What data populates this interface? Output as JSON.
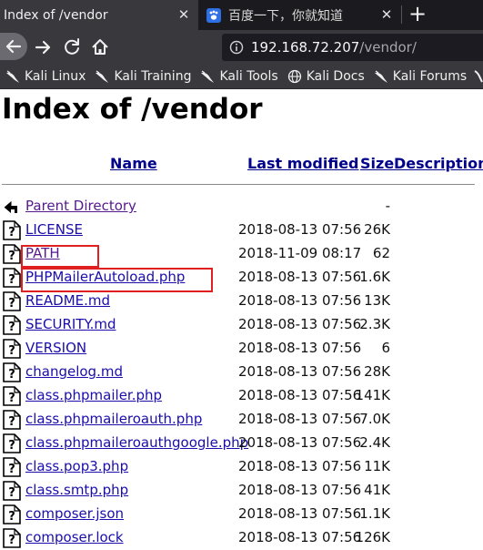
{
  "browser": {
    "tabs": [
      {
        "title": "Index of /vendor",
        "active": true
      },
      {
        "title": "百度一下，你就知道",
        "active": false,
        "icon": "baidu-paw-icon"
      }
    ],
    "url_host": "192.168.72.207",
    "url_path": "/vendor/",
    "bookmarks": [
      {
        "label": "Kali Linux",
        "icon": "kali-dragon-icon"
      },
      {
        "label": "Kali Training",
        "icon": "kali-dragon-icon"
      },
      {
        "label": "Kali Tools",
        "icon": "kali-dragon-icon"
      },
      {
        "label": "Kali Docs",
        "icon": "globe-icon"
      },
      {
        "label": "Kali Forums",
        "icon": "kali-dragon-icon"
      }
    ]
  },
  "page": {
    "title": "Index of /vendor",
    "headers": {
      "name": "Name",
      "last_modified": "Last modified",
      "size": "Size",
      "description": "Description"
    },
    "rows": [
      {
        "name": "Parent Directory",
        "date": "",
        "size": "-",
        "icon": "back-arrow-icon",
        "visited": true
      },
      {
        "name": "LICENSE",
        "date": "2018-08-13 07:56",
        "size": "26K",
        "icon": "unknown-file-icon"
      },
      {
        "name": "PATH",
        "date": "2018-11-09 08:17",
        "size": "62",
        "icon": "unknown-file-icon",
        "visited": true,
        "highlighted": true
      },
      {
        "name": "PHPMailerAutoload.php",
        "date": "2018-08-13 07:56",
        "size": "1.6K",
        "icon": "unknown-file-icon",
        "highlighted": true
      },
      {
        "name": "README.md",
        "date": "2018-08-13 07:56",
        "size": "13K",
        "icon": "unknown-file-icon"
      },
      {
        "name": "SECURITY.md",
        "date": "2018-08-13 07:56",
        "size": "2.3K",
        "icon": "unknown-file-icon"
      },
      {
        "name": "VERSION",
        "date": "2018-08-13 07:56",
        "size": "6",
        "icon": "unknown-file-icon"
      },
      {
        "name": "changelog.md",
        "date": "2018-08-13 07:56",
        "size": "28K",
        "icon": "unknown-file-icon"
      },
      {
        "name": "class.phpmailer.php",
        "date": "2018-08-13 07:56",
        "size": "141K",
        "icon": "unknown-file-icon"
      },
      {
        "name": "class.phpmaileroauth.php",
        "date": "2018-08-13 07:56",
        "size": "7.0K",
        "icon": "unknown-file-icon"
      },
      {
        "name": "class.phpmaileroauthgoogle.php",
        "date": "2018-08-13 07:56",
        "size": "2.4K",
        "icon": "unknown-file-icon"
      },
      {
        "name": "class.pop3.php",
        "date": "2018-08-13 07:56",
        "size": "11K",
        "icon": "unknown-file-icon"
      },
      {
        "name": "class.smtp.php",
        "date": "2018-08-13 07:56",
        "size": "41K",
        "icon": "unknown-file-icon"
      },
      {
        "name": "composer.json",
        "date": "2018-08-13 07:56",
        "size": "1.1K",
        "icon": "unknown-file-icon"
      },
      {
        "name": "composer.lock",
        "date": "2018-08-13 07:56",
        "size": "126K",
        "icon": "unknown-file-icon"
      }
    ],
    "colors": {
      "link": "#1a0dab",
      "visited": "#551a8b",
      "header_link": "#00008b",
      "annotation": "#e02020"
    }
  }
}
